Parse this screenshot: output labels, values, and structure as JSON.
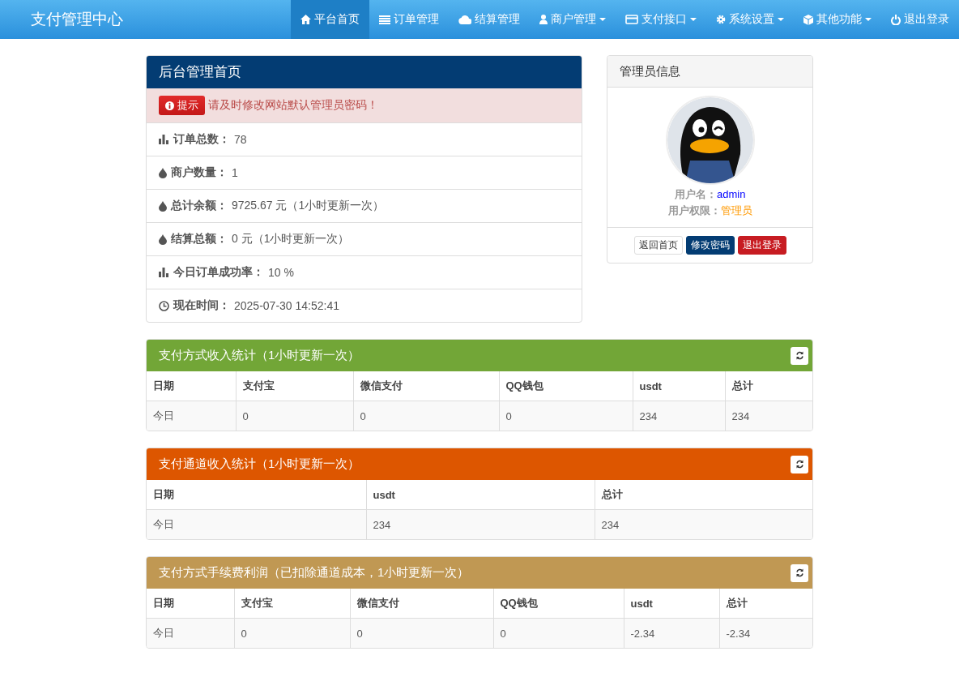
{
  "navbar": {
    "brand": "支付管理中心",
    "items": [
      {
        "label": "平台首页",
        "kind": "home",
        "dropdown": false,
        "selected": true
      },
      {
        "label": "订单管理",
        "kind": "list",
        "dropdown": false,
        "selected": false
      },
      {
        "label": "结算管理",
        "kind": "cloud",
        "dropdown": false,
        "selected": false
      },
      {
        "label": "商户管理",
        "kind": "user",
        "dropdown": true,
        "selected": false
      },
      {
        "label": "支付接口",
        "kind": "card",
        "dropdown": true,
        "selected": false
      },
      {
        "label": "系统设置",
        "kind": "gear",
        "dropdown": true,
        "selected": false
      },
      {
        "label": "其他功能",
        "kind": "cube",
        "dropdown": true,
        "selected": false
      },
      {
        "label": "退出登录",
        "kind": "power",
        "dropdown": false,
        "selected": false
      }
    ]
  },
  "overview": {
    "title": "后台管理首页",
    "alert": {
      "badge": "提示",
      "message": "请及时修改网站默认管理员密码！"
    },
    "stats": [
      {
        "kind": "bars",
        "label": "订单总数：",
        "value": "78"
      },
      {
        "kind": "drop",
        "label": "商户数量：",
        "value": "1"
      },
      {
        "kind": "drop",
        "label": "总计余额：",
        "value": "9725.67 元（1小时更新一次）"
      },
      {
        "kind": "drop",
        "label": "结算总额：",
        "value": "0 元（1小时更新一次）"
      },
      {
        "kind": "bars",
        "label": "今日订单成功率：",
        "value": "10 %"
      },
      {
        "kind": "clock",
        "label": "现在时间：",
        "value": "2025-07-30 14:52:41"
      }
    ]
  },
  "admin_info": {
    "title": "管理员信息",
    "username_label": "用户名：",
    "username": "admin",
    "role_label": "用户权限：",
    "role": "管理员",
    "buttons": [
      {
        "label": "返回首页",
        "kind": "default"
      },
      {
        "label": "修改密码",
        "kind": "primary"
      },
      {
        "label": "退出登录",
        "kind": "danger"
      }
    ]
  },
  "tables": [
    {
      "title": "支付方式收入统计（1小时更新一次）",
      "color": "#72a637",
      "columns": [
        "日期",
        "支付宝",
        "微信支付",
        "QQ钱包",
        "usdt",
        "总计"
      ],
      "rows": [
        [
          "今日",
          "0",
          "0",
          "0",
          "234",
          "234"
        ]
      ]
    },
    {
      "title": "支付通道收入统计（1小时更新一次）",
      "color": "#dd5600",
      "columns": [
        "日期",
        "usdt",
        "总计"
      ],
      "rows": [
        [
          "今日",
          "234",
          "234"
        ]
      ]
    },
    {
      "title": "支付方式手续费利润（已扣除通道成本，1小时更新一次）",
      "color": "#c09853",
      "columns": [
        "日期",
        "支付宝",
        "微信支付",
        "QQ钱包",
        "usdt",
        "总计"
      ],
      "rows": [
        [
          "今日",
          "0",
          "0",
          "0",
          "-2.34",
          "-2.34"
        ]
      ]
    }
  ]
}
